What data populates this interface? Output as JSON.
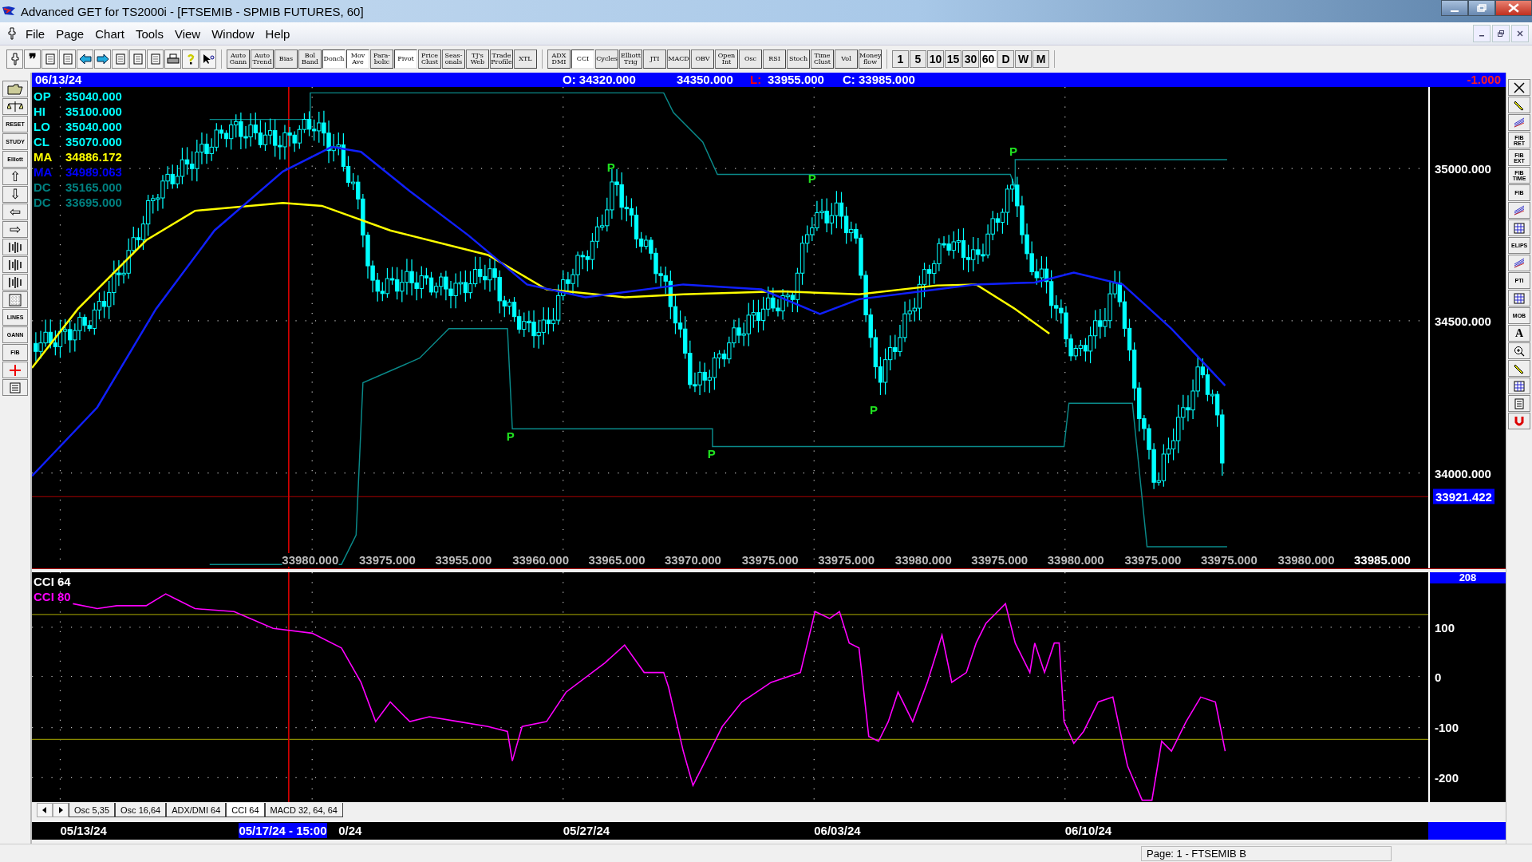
{
  "window": {
    "title": "Advanced GET for TS2000i - [FTSEMIB - SPMIB FUTURES, 60]"
  },
  "menu": [
    "File",
    "Page",
    "Chart",
    "Tools",
    "View",
    "Window",
    "Help"
  ],
  "toolbar": {
    "tools": [
      {
        "kind": "pin"
      },
      {
        "kind": "quote",
        "label": "❞"
      },
      {
        "kind": "page"
      },
      {
        "kind": "save"
      },
      {
        "kind": "left"
      },
      {
        "kind": "right"
      },
      {
        "kind": "copy"
      },
      {
        "kind": "delete"
      },
      {
        "kind": "grid"
      },
      {
        "kind": "print"
      },
      {
        "kind": "help"
      },
      {
        "kind": "pointer"
      }
    ],
    "studies": [
      {
        "label": "Auto Gann",
        "on": false
      },
      {
        "label": "Auto Trend",
        "on": false
      },
      {
        "label": "Bias",
        "on": false
      },
      {
        "label": "Bol Band",
        "on": false
      },
      {
        "label": "Donch",
        "on": true
      },
      {
        "label": "Mov Ave",
        "on": true
      },
      {
        "label": "Para- bolic",
        "on": false
      },
      {
        "label": "Pivot",
        "on": true
      },
      {
        "label": "Price Clust",
        "on": false
      },
      {
        "label": "Seas- onals",
        "on": false
      },
      {
        "label": "TJ's Web",
        "on": false
      },
      {
        "label": "Trade Profile",
        "on": false
      },
      {
        "label": "XTL",
        "on": false
      }
    ],
    "indicators": [
      {
        "label": "ADX DMI",
        "on": false
      },
      {
        "label": "CCI",
        "on": true
      },
      {
        "label": "Cycles",
        "on": false
      },
      {
        "label": "Elliott Trig",
        "on": false
      },
      {
        "label": "JTI",
        "on": false
      },
      {
        "label": "MACD",
        "on": false
      },
      {
        "label": "OBV",
        "on": false
      },
      {
        "label": "Open Int",
        "on": false
      },
      {
        "label": "Osc",
        "on": false
      },
      {
        "label": "RSI",
        "on": false
      },
      {
        "label": "Stoch",
        "on": false
      },
      {
        "label": "Time Clust",
        "on": false
      },
      {
        "label": "Vol",
        "on": false
      },
      {
        "label": "Money flow",
        "on": false
      }
    ],
    "intervals": [
      {
        "label": "1",
        "selected": false
      },
      {
        "label": "5",
        "selected": false
      },
      {
        "label": "10",
        "selected": false
      },
      {
        "label": "15",
        "selected": false
      },
      {
        "label": "30",
        "selected": false
      },
      {
        "label": "60",
        "selected": true
      },
      {
        "label": "D",
        "selected": false
      },
      {
        "label": "W",
        "selected": false
      },
      {
        "label": "M",
        "selected": false
      }
    ]
  },
  "info_bar": {
    "date": "06/13/24",
    "open": "O: 34320.000",
    "high": "34350.000",
    "low_label": "L:",
    "low": "33955.000",
    "close": "C: 33985.000",
    "change": "-1.000"
  },
  "left_tools": [
    {
      "kind": "folder"
    },
    {
      "kind": "scale"
    },
    {
      "kind": "label",
      "label": "RESET"
    },
    {
      "kind": "label",
      "label": "STUDY"
    },
    {
      "kind": "label",
      "label": "Elliott"
    },
    {
      "kind": "glyph",
      "label": "⇧"
    },
    {
      "kind": "glyph",
      "label": "⇩"
    },
    {
      "kind": "glyph",
      "label": "⇦"
    },
    {
      "kind": "glyph",
      "label": "⇨"
    },
    {
      "kind": "bars"
    },
    {
      "kind": "bars"
    },
    {
      "kind": "bars"
    },
    {
      "kind": "grid"
    },
    {
      "kind": "label",
      "label": "LINES"
    },
    {
      "kind": "label",
      "label": "GANN"
    },
    {
      "kind": "label",
      "label": "FIB"
    },
    {
      "kind": "cross"
    },
    {
      "kind": "page"
    }
  ],
  "right_tools": [
    {
      "kind": "close"
    },
    {
      "kind": "pencil"
    },
    {
      "kind": "lines"
    },
    {
      "kind": "label",
      "label": "FIB RET"
    },
    {
      "kind": "label",
      "label": "FIB EXT"
    },
    {
      "kind": "label",
      "label": "FIB TIME"
    },
    {
      "kind": "label",
      "label": "FIB"
    },
    {
      "kind": "lines"
    },
    {
      "kind": "grid"
    },
    {
      "kind": "label",
      "label": "ELIPS"
    },
    {
      "kind": "lines"
    },
    {
      "kind": "label",
      "label": "PTI"
    },
    {
      "kind": "grid"
    },
    {
      "kind": "label",
      "label": "MOB"
    },
    {
      "kind": "glyph",
      "label": "A"
    },
    {
      "kind": "zoom"
    },
    {
      "kind": "pencil"
    },
    {
      "kind": "grid"
    },
    {
      "kind": "page"
    },
    {
      "kind": "magnet"
    }
  ],
  "price_chart": {
    "legend": [
      {
        "label": "OP",
        "value": "35040.000",
        "color": "#00ffff"
      },
      {
        "label": "HI",
        "value": "35100.000",
        "color": "#00ffff"
      },
      {
        "label": "LO",
        "value": "35040.000",
        "color": "#00ffff"
      },
      {
        "label": "CL",
        "value": "35070.000",
        "color": "#00ffff"
      },
      {
        "label": "MA",
        "value": "34886.172",
        "color": "#ffff00"
      },
      {
        "label": "MA",
        "value": "34989.063",
        "color": "#0000ff"
      },
      {
        "label": "DC",
        "value": "35165.000",
        "color": "#008080"
      },
      {
        "label": "DC",
        "value": "33695.000",
        "color": "#008080"
      }
    ],
    "y_axis": [
      "35000.000",
      "34500.000",
      "34000.000"
    ],
    "marker": "33921.422",
    "pivots": [
      "P",
      "P",
      "P",
      "P",
      "P",
      "P"
    ],
    "bar_values": [
      "33980.000",
      "33975.000",
      "33955.000",
      "33960.000",
      "33965.000",
      "33970.000",
      "33975.000",
      "33975.000",
      "33980.000",
      "33975.000",
      "33980.000",
      "33975.000",
      "33975.000",
      "33980.000"
    ],
    "last_value": "33985.000"
  },
  "cci_chart": {
    "legend": [
      {
        "label": "CCI 64",
        "color": "#ffffff"
      },
      {
        "label": "CCI  80",
        "color": "#ff00ff"
      }
    ],
    "y_axis": [
      "100",
      "0",
      "-100",
      "-200"
    ],
    "marker": "208"
  },
  "tabs": [
    {
      "label": "Osc 5,35",
      "selected": false
    },
    {
      "label": "Osc 16,64",
      "selected": false
    },
    {
      "label": "ADX/DMI 64",
      "selected": false
    },
    {
      "label": "CCI 64",
      "selected": true
    },
    {
      "label": "MACD 32, 64, 64",
      "selected": false
    }
  ],
  "dates": {
    "labels": [
      "05/13/24",
      "0/24",
      "05/27/24",
      "06/03/24",
      "06/10/24"
    ],
    "cursor": "05/17/24 - 15:00"
  },
  "status_bar": "Page: 1 - FTSEMIB B"
}
